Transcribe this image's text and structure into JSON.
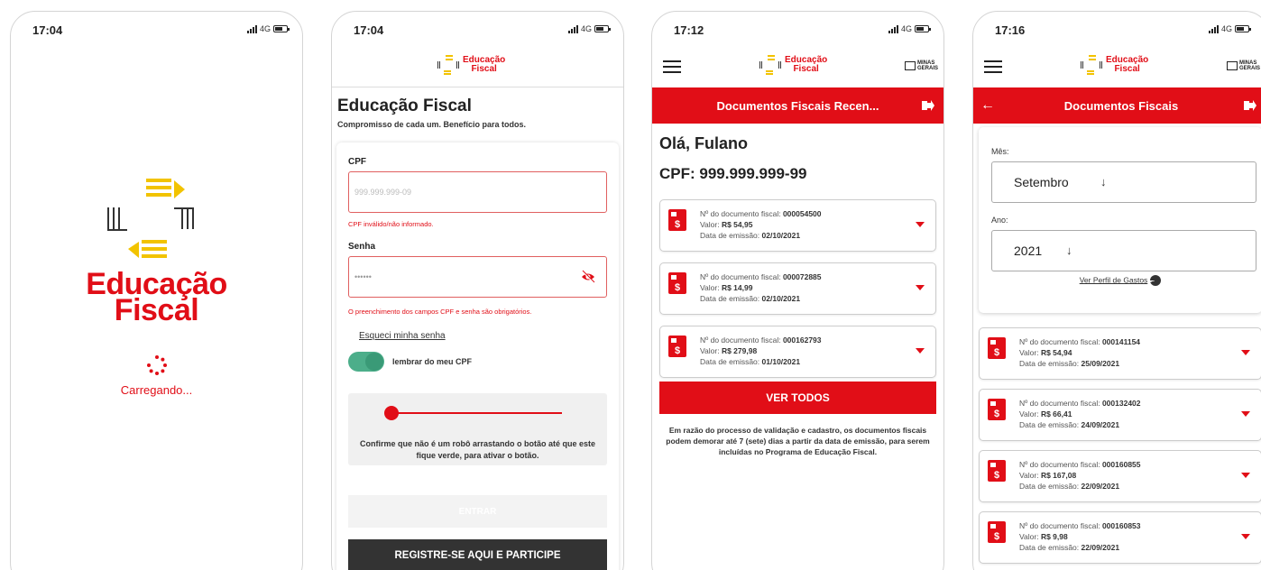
{
  "statusbar": {
    "p1_time": "17:04",
    "p2_time": "17:04",
    "p3_time": "17:12",
    "p4_time": "17:16",
    "network": "4G"
  },
  "brand": {
    "logo_line1": "Educação",
    "logo_line2": "Fiscal",
    "state_line1": "MINAS",
    "state_line2": "GERAIS",
    "red": "#e10e17"
  },
  "splash": {
    "loading_text": "Carregando..."
  },
  "login": {
    "title": "Educação Fiscal",
    "subtitle": "Compromisso de cada um. Benefício para todos.",
    "cpf_label": "CPF",
    "cpf_placeholder": "999.999.999-09",
    "cpf_error": "CPF inválido/não informado.",
    "password_label": "Senha",
    "password_value": "••••••",
    "required_error": "O preenchimento dos campos CPF e senha são obrigatórios.",
    "forgot_link": "Esqueci minha senha",
    "remember_label": "lembrar do meu CPF",
    "captcha_text": "Confirme que não é um robô arrastando o botão até que este fique verde, para ativar o botão.",
    "enter_button": "ENTRAR",
    "register_button": "REGISTRE-SE AQUI E PARTICIPE"
  },
  "recent": {
    "header_title": "Documentos Fiscais Recen...",
    "greeting_prefix": "Olá,",
    "user_name": "Fulano",
    "cpf_line": "CPF: 999.999.999-99",
    "doc_label": "Nº do documento fiscal:",
    "value_label": "Valor:",
    "date_label": "Data de emissão:",
    "documents": [
      {
        "number": "000054500",
        "value": "R$ 54,95",
        "date": "02/10/2021"
      },
      {
        "number": "000072885",
        "value": "R$ 14,99",
        "date": "02/10/2021"
      },
      {
        "number": "000162793",
        "value": "R$ 279,98",
        "date": "01/10/2021"
      }
    ],
    "see_all_button": "VER TODOS",
    "notice": "Em razão do processo de validação e cadastro, os documentos fiscais podem demorar até 7 (sete) dias a partir da data de emissão, para serem incluídas no Programa de Educação Fiscal."
  },
  "list": {
    "header_title": "Documentos Fiscais",
    "month_label": "Mês:",
    "month_value": "Setembro",
    "year_label": "Ano:",
    "year_value": "2021",
    "profile_link": "Ver Perfil de Gastos",
    "documents": [
      {
        "number": "000141154",
        "value": "R$ 54,94",
        "date": "25/09/2021"
      },
      {
        "number": "000132402",
        "value": "R$ 66,41",
        "date": "24/09/2021"
      },
      {
        "number": "000160855",
        "value": "R$ 167,08",
        "date": "22/09/2021"
      },
      {
        "number": "000160853",
        "value": "R$ 9,98",
        "date": "22/09/2021"
      }
    ]
  }
}
